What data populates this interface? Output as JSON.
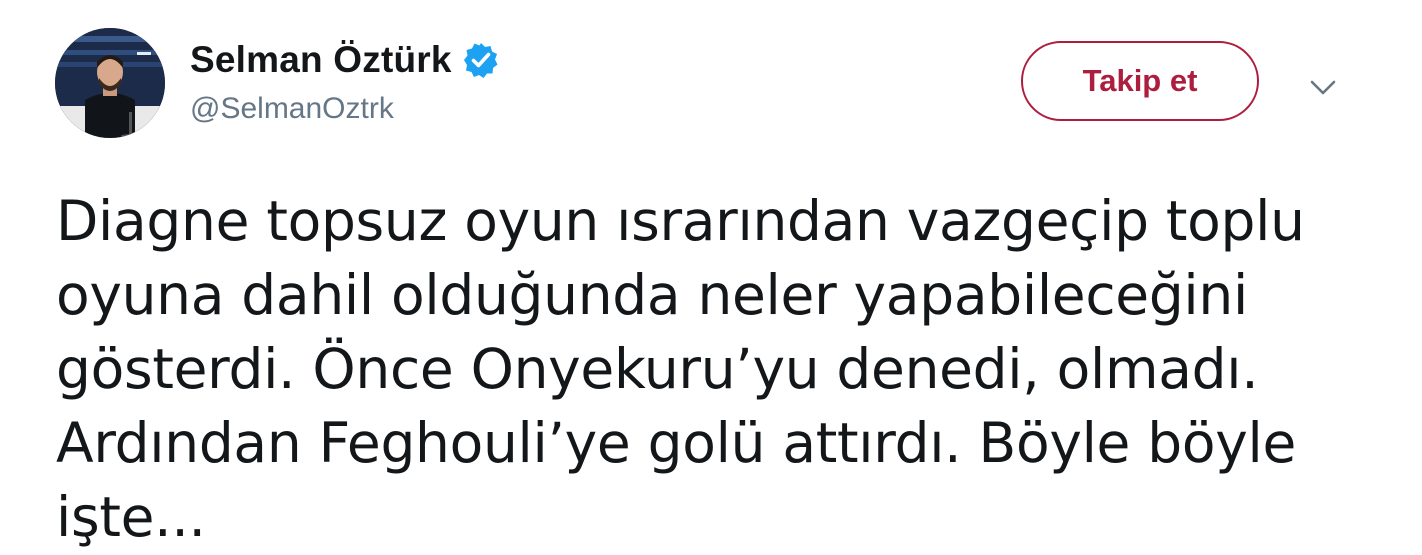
{
  "author": {
    "display_name": "Selman Öztürk",
    "handle": "@SelmanOztrk",
    "verified": true
  },
  "follow_button": {
    "label": "Takip et"
  },
  "tweet": {
    "text": "Diagne topsuz oyun ısrarından vazgeçip toplu\noyuna dahil olduğunda neler yapabileceğini\ngösterdi. Önce Onyekuru’yu denedi, olmadı.\nArdından Feghouli’ye golü attırdı. Böyle böyle\nişte..."
  },
  "icons": {
    "verified": "verified-badge-icon",
    "more": "chevron-down-icon"
  },
  "colors": {
    "follow_accent": "#ad1e3e",
    "verified_blue": "#1da1f2",
    "handle_gray": "#657786",
    "text": "#14171a"
  }
}
